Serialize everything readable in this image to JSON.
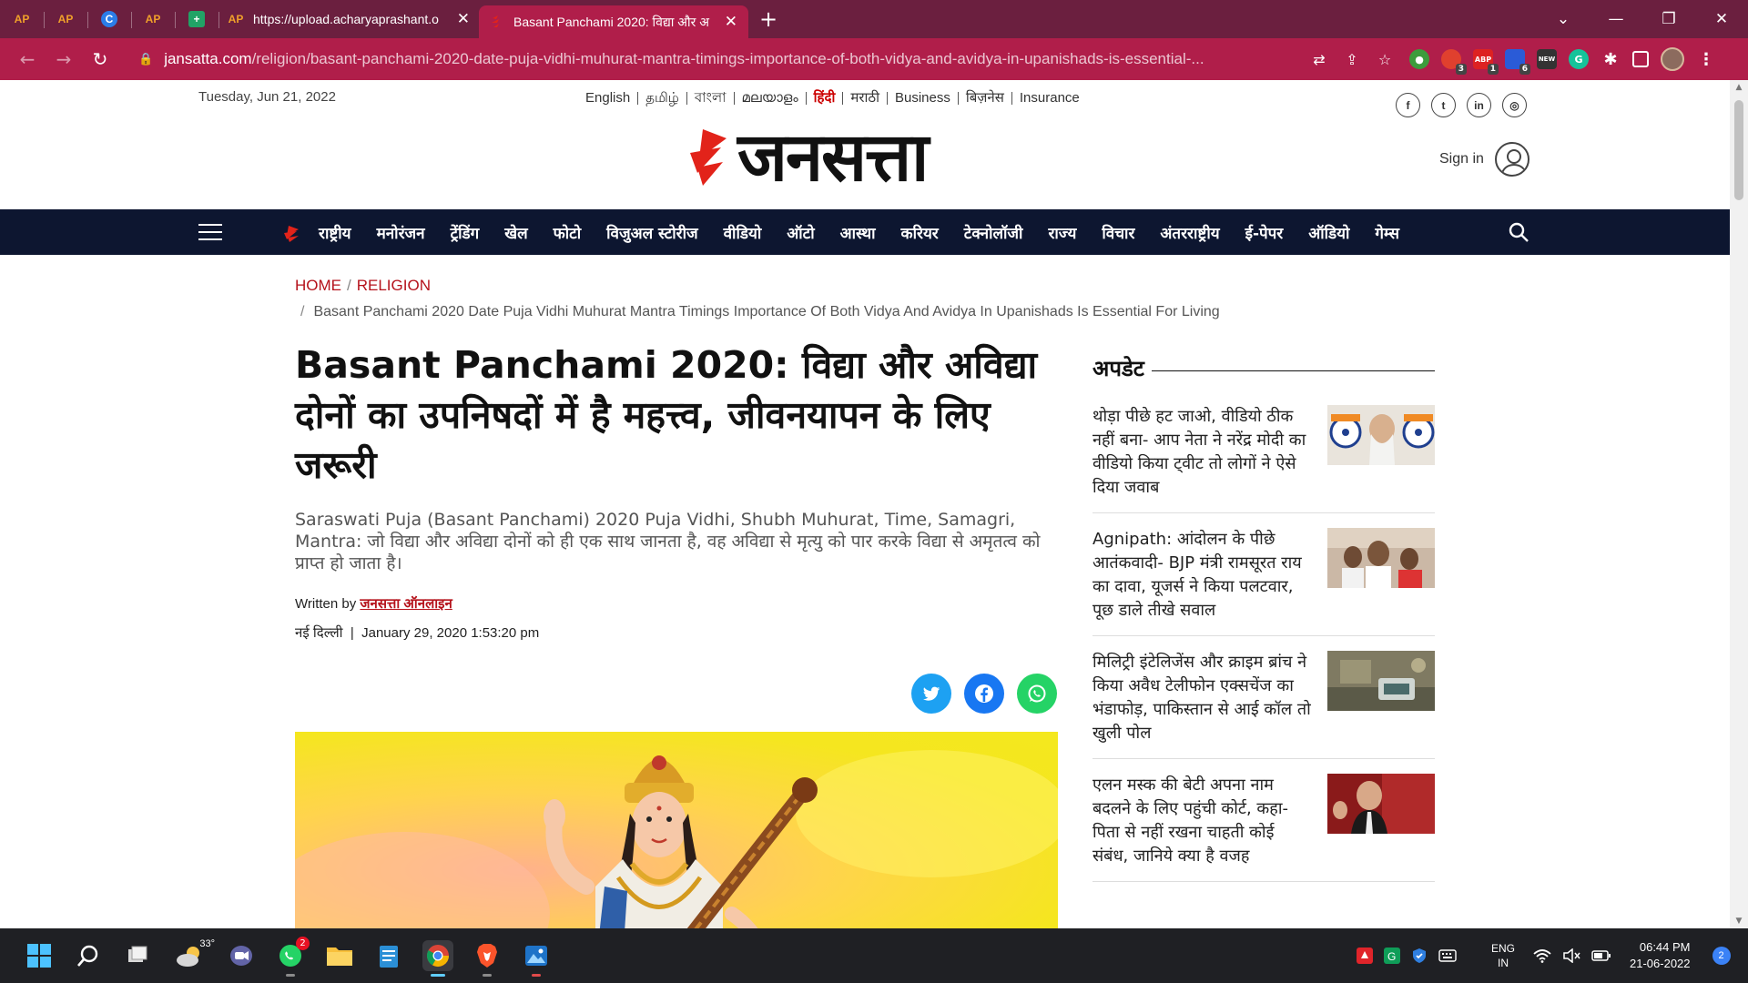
{
  "browser": {
    "tabs": [
      {
        "favicon": "AP"
      },
      {
        "favicon": "AP"
      },
      {
        "favicon": "C"
      },
      {
        "favicon": "AP"
      },
      {
        "favicon": "+"
      },
      {
        "favicon": "AP",
        "title": "https://upload.acharyaprashant.o"
      },
      {
        "favicon": "J",
        "title": "Basant Panchami 2020: विद्या और अ",
        "active": true
      }
    ],
    "url_domain": "jansatta.com",
    "url_path": "/religion/basant-panchami-2020-date-puja-vidhi-muhurat-mantra-timings-importance-of-both-vidya-and-avidya-in-upanishads-is-essential-...",
    "extension_badges": {
      "e1": "3",
      "abp": "1",
      "e3": "6",
      "new": "NEW",
      "abp_label": "ABP"
    },
    "accent": "#b01e4a"
  },
  "site": {
    "date": "Tuesday, Jun 21, 2022",
    "languages": [
      "English",
      "தமிழ்",
      "বাংলা",
      "മലയാളം",
      "हिंदी",
      "मराठी",
      "Business",
      "बिज़नेस",
      "Insurance"
    ],
    "active_language": "हिंदी",
    "logo_text": "जनसत्ता",
    "signin_label": "Sign in",
    "nav": [
      "राष्ट्रीय",
      "मनोरंजन",
      "ट्रेंडिंग",
      "खेल",
      "फोटो",
      "विजुअल स्टोरीज",
      "वीडियो",
      "ऑटो",
      "आस्था",
      "करियर",
      "टेक्नोलॉजी",
      "राज्य",
      "विचार",
      "अंतरराष्ट्रीय",
      "ई-पेपर",
      "ऑडियो",
      "गेम्स"
    ]
  },
  "breadcrumb": {
    "home": "HOME",
    "section": "RELIGION",
    "current": "Basant Panchami 2020 Date Puja Vidhi Muhurat Mantra Timings Importance Of Both Vidya And Avidya In Upanishads Is Essential For Living"
  },
  "article": {
    "headline": "Basant Panchami 2020: विद्या और अविद्या दोनों का उपनिषदों में है महत्त्व, जीवनयापन के लिए जरूरी",
    "summary": "Saraswati Puja (Basant Panchami) 2020 Puja Vidhi, Shubh Muhurat, Time, Samagri, Mantra: जो विद्या और अविद्या दोनों को ही एक साथ जानता है, वह अविद्या से मृत्यु को पार करके विद्या से अमृतत्व को प्राप्त हो जाता है।",
    "written_by_label": "Written by",
    "author": "जनसत्ता ऑनलाइन",
    "location": "नई दिल्ली",
    "published": "January 29, 2020 1:53:20 pm"
  },
  "sidebar": {
    "title": "अपडेट",
    "items": [
      {
        "text": "थोड़ा पीछे हट जाओ, वीडियो ठीक नहीं बना- आप नेता ने नरेंद्र मोदी का वीडियो किया ट्वीट तो लोगों ने ऐसे दिया जवाब"
      },
      {
        "text": "Agnipath: आंदोलन के पीछे आतंकवादी- BJP मंत्री रामसूरत राय का दावा, यूजर्स ने किया पलटवार, पूछ डाले तीखे सवाल"
      },
      {
        "text": "मिलिट्री इंटेलिजेंस और क्राइम ब्रांच ने किया अवैध टेलीफोन एक्सचेंज का भंडाफोड़, पाकिस्तान से आई कॉल तो खुली पोल"
      },
      {
        "text": "एलन मस्क की बेटी अपना नाम बदलने के लिए पहुंची कोर्ट, कहा- पिता से नहीं रखना चाहती कोई संबंध, जानिये क्या है वजह"
      }
    ]
  },
  "taskbar": {
    "weather": "33°",
    "whatsapp_badge": "2",
    "lang_line1": "ENG",
    "lang_line2": "IN",
    "time": "06:44 PM",
    "date": "21-06-2022",
    "notifications": "2"
  }
}
